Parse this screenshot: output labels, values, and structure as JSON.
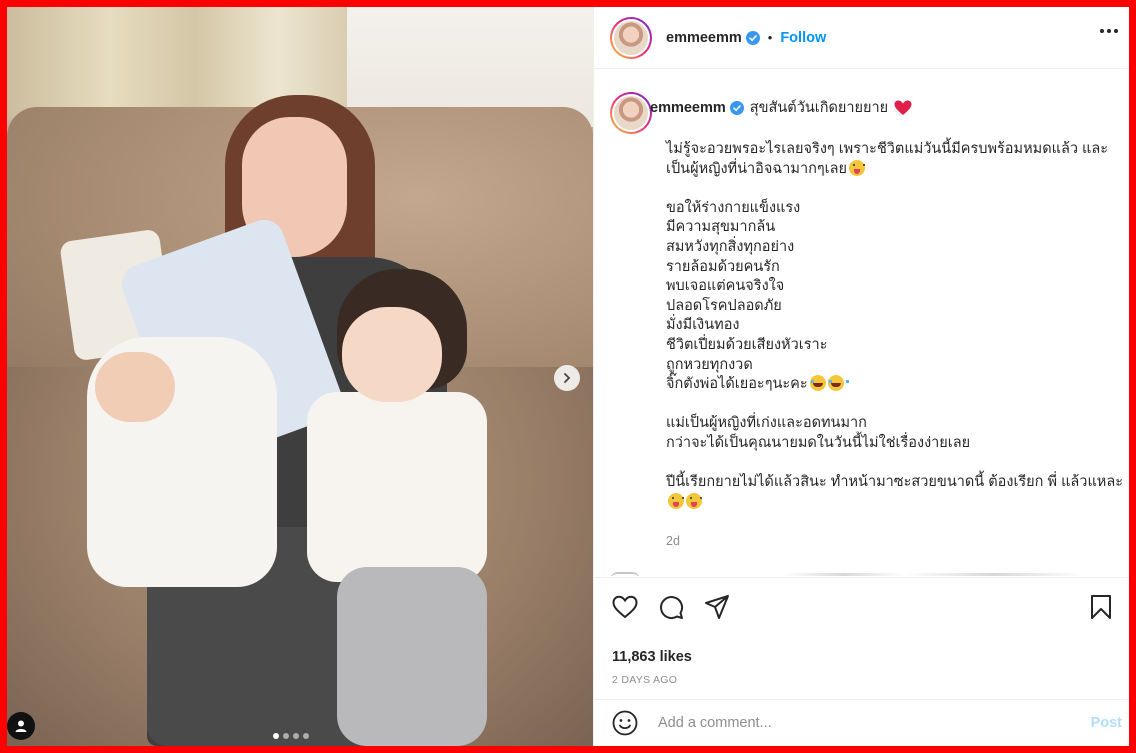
{
  "media": {
    "next_icon": "chevron-right-icon",
    "user_tag_icon": "user-icon",
    "carousel_dots": 4,
    "active_dot": 0
  },
  "header": {
    "username": "emmeemm",
    "separator": "•",
    "follow_label": "Follow",
    "more_icon": "more-horizontal-icon"
  },
  "caption": {
    "username": "emmeemm",
    "title": "สุขสันต์วันเกิดยายยาย",
    "paragraphs": [
      "ไม่รู้จะอวยพรอะไรเลยจริงๆ เพราะชีวิตแม่วันนี้มีครบพร้อมหมดแล้ว และเป็นผู้หญิงที่น่าอิจฉามากๆเลย",
      "ขอให้ร่างกายแข็งแรง",
      "มีความสุขมากล้น",
      "สมหวังทุกสิ่งทุกอย่าง",
      "รายล้อมด้วยคนรัก",
      "พบเจอแต่คนจริงใจ",
      "ปลอดโรคปลอดภัย",
      "มั่งมีเงินทอง",
      "ชีวิตเปี่ยมด้วยเสียงหัวเราะ",
      "ถูกหวยทุกงวด",
      "จิ๊กตังพ่อได้เยอะๆนะคะ",
      "แม่เป็นผู้หญิงที่เก่งและอดทนมาก",
      "กว่าจะได้เป็นคุณนายมดในวันนี้ไม่ใช่เรื่องง่ายเลย",
      "ปีนี้เรียกยายไม่ได้แล้วสินะ ทำหน้ามาซะสวยขนาดนี้ ต้องเรียก พี่ แล้วแหละ"
    ],
    "timestamp": "2d"
  },
  "actions": {
    "like_icon": "heart-icon",
    "comment_icon": "comment-icon",
    "share_icon": "send-icon",
    "save_icon": "bookmark-icon",
    "likes": "11,863 likes",
    "date": "2 DAYS AGO"
  },
  "add_comment": {
    "emoji_icon": "smile-icon",
    "placeholder": "Add a comment...",
    "post_label": "Post"
  },
  "colors": {
    "accent": "#0095f6",
    "post_disabled": "#b2dffc",
    "border": "#efefef",
    "frame": "#ff0000"
  }
}
